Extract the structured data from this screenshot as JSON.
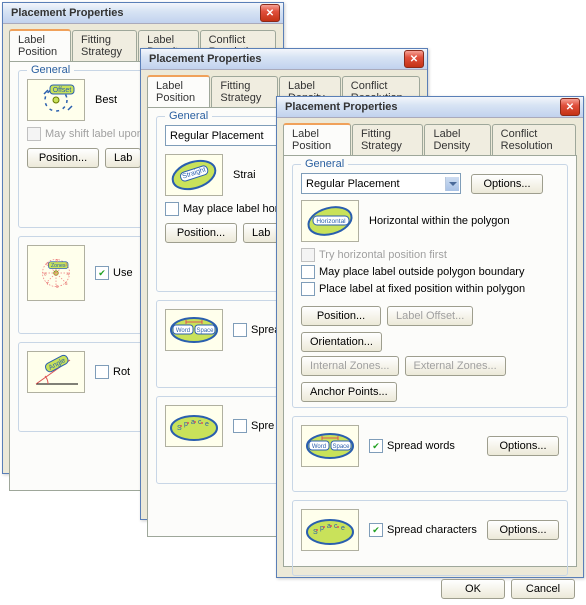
{
  "title": "Placement Properties",
  "tabs": [
    "Label Position",
    "Fitting Strategy",
    "Label Density",
    "Conflict Resolution"
  ],
  "general_legend": "General",
  "win1": {
    "offset_label": "Offset",
    "best_prefix": "Best",
    "shift_label": "May shift label upon fix",
    "position_btn": "Position...",
    "label_btn": "Lab",
    "zones_label": "Zones",
    "use_prefix": "Use",
    "angle_label": "Angle",
    "rot_prefix": "Rot"
  },
  "win2": {
    "reg_placement": "Regular Placement",
    "straight_label": "Straight",
    "strai_prefix": "Strai",
    "may_place_horiz": "May place label horizon",
    "position_btn": "Position...",
    "label_btn": "Lab",
    "word_label": "Word",
    "space_label": "Space",
    "spread_prefix": "Sprea",
    "space_text": "S·p·a·c·e",
    "spread_prefix2": "Spre"
  },
  "win3": {
    "reg_placement": "Regular Placement",
    "options_btn": "Options...",
    "horiz_label": "Horizontal",
    "horiz_text": "Horizontal within the polygon",
    "try_horiz": "Try horizontal position first",
    "may_outside": "May place label outside polygon boundary",
    "fixed_pos": "Place label at fixed position within polygon",
    "position_btn": "Position...",
    "label_offset_btn": "Label Offset...",
    "orientation_btn": "Orientation...",
    "internal_zones_btn": "Internal Zones...",
    "external_zones_btn": "External Zones...",
    "anchor_btn": "Anchor Points...",
    "word_label": "Word",
    "space_label": "Space",
    "spread_words": "Spread words",
    "space_text": "S·p·a·c·e",
    "spread_chars": "Spread characters",
    "ok_btn": "OK",
    "cancel_btn": "Cancel"
  }
}
